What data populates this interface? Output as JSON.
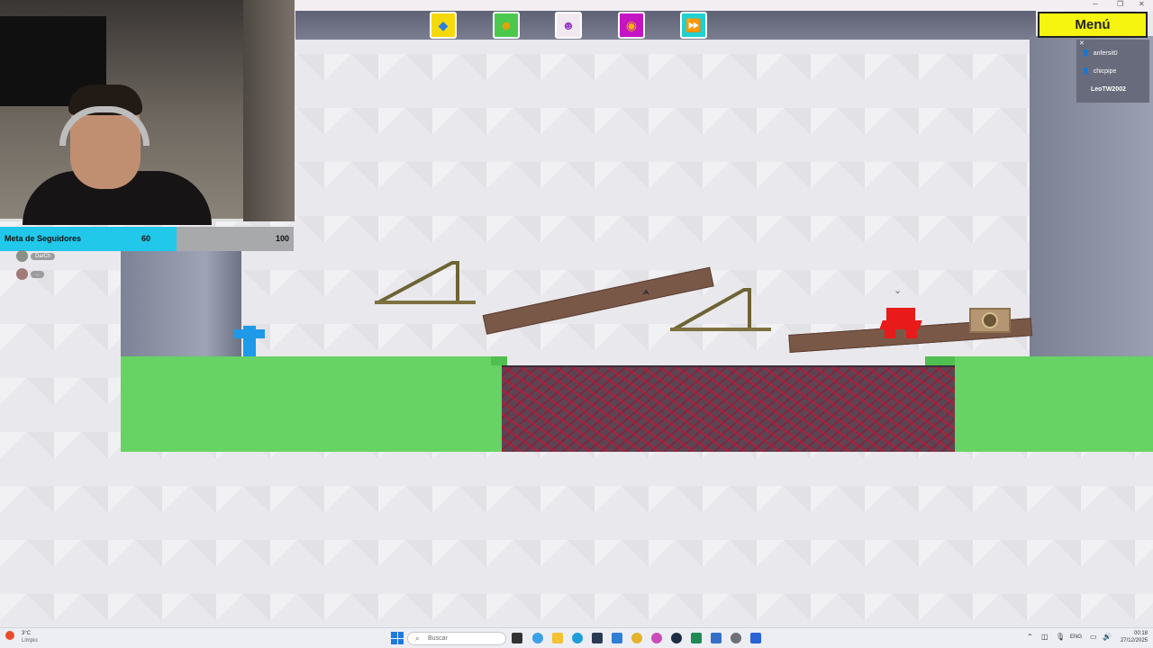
{
  "stream_overlay": {
    "goal_label": "Meta de Seguidores",
    "goal_current": "60",
    "goal_max": "100",
    "goal_progress": 0.6,
    "chat_users": [
      {
        "name": "DarCh"
      },
      {
        "name": "..."
      }
    ]
  },
  "game": {
    "menu_label": "Menú",
    "powerups": [
      {
        "icon": "blue-fish-icon",
        "color": "#f5d90a"
      },
      {
        "icon": "green-character-icon",
        "color": "#4cc94c"
      },
      {
        "icon": "purple-devil-icon",
        "color": "#f0e9f0"
      },
      {
        "icon": "color-wheel-icon",
        "color": "#c414c4"
      },
      {
        "icon": "fast-forward-icon",
        "color": "#22d0cf"
      }
    ],
    "players": [
      {
        "name": "anfersit0"
      },
      {
        "name": "chicpipe"
      },
      {
        "name": "LeoTW2002"
      }
    ]
  },
  "taskbar": {
    "weather_temp": "3°C",
    "weather_desc": "Limpio",
    "search_placeholder": "Buscar",
    "language": "ENG",
    "time": "00:18",
    "date": "27/12/2025"
  }
}
